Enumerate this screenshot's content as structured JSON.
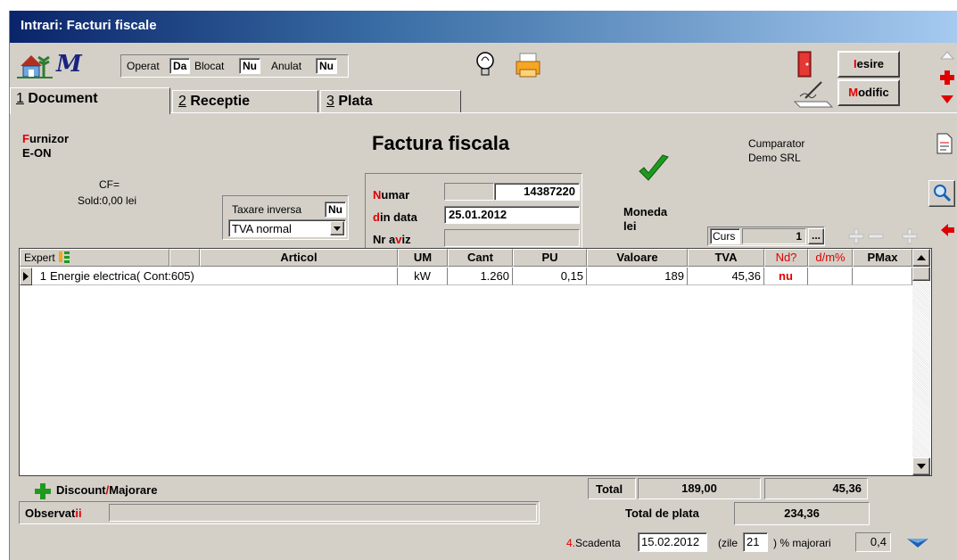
{
  "window": {
    "title": "Intrari: Facturi fiscale"
  },
  "toolbar": {
    "operat_label": "Operat",
    "operat_value": "Da",
    "blocat_label": "Blocat",
    "blocat_value": "Nu",
    "anulat_label": "Anulat",
    "anulat_value": "Nu",
    "iesire_hot": "I",
    "iesire_rest": "esire",
    "modific_hot": "M",
    "modific_rest": "odific"
  },
  "tabs": [
    {
      "num": "1",
      "label": "Document"
    },
    {
      "num": "2",
      "label": "Receptie"
    },
    {
      "num": "3",
      "label": "Plata"
    }
  ],
  "header": {
    "furnizor_hot": "F",
    "furnizor_rest": "urnizor",
    "furnizor_name": "E-ON",
    "cf_label": "CF=",
    "sold_label": "Sold:0,00 lei",
    "doc_title": "Factura fiscala",
    "cumparator_label": "Cumparator",
    "cumparator_name": "Demo SRL",
    "taxare_label": "Taxare inversa",
    "taxare_value": "Nu",
    "tva_select": "TVA normal",
    "numar_hot": "N",
    "numar_rest": "umar",
    "numar_series": "",
    "numar_value": "14387220",
    "din_hot": "d",
    "din_rest": "in data",
    "din_value": "25.01.2012",
    "aviz_pre": "Nr a",
    "aviz_hot": "v",
    "aviz_post": "iz",
    "aviz_value": "",
    "moneda_label": "Moneda",
    "moneda_value": "lei",
    "curs_label": "Curs",
    "curs_value": "1",
    "curs_btn": "..."
  },
  "grid": {
    "headers": {
      "expert": "Expert",
      "articol": "Articol",
      "um": "UM",
      "cant": "Cant",
      "pu": "PU",
      "valoare": "Valoare",
      "tva": "TVA",
      "nd": "Nd?",
      "dm": "d/m%",
      "pmax": "PMax"
    },
    "rows": [
      {
        "nr": "1",
        "articol": "Energie electrica( Cont:605)",
        "um": "kW",
        "cant": "1.260",
        "pu": "0,15",
        "valoare": "189",
        "tva": "45,36",
        "nd": "nu",
        "dm": "",
        "pmax": ""
      }
    ]
  },
  "footer": {
    "discount_label": "Discount",
    "majorare_label": "Majorare",
    "discount_sep": "/",
    "total_label": "Total",
    "total_value": "189,00",
    "total_tva": "45,36",
    "obs_pre": "Observat",
    "obs_hot": "ii",
    "obs_value": "",
    "total_plata_label": "Total de plata",
    "total_plata_value": "234,36",
    "scadenta_num": "4.",
    "scadenta_label": "Scadenta",
    "scadenta_value": "15.02.2012",
    "zile_label": "(zile",
    "zile_value": "21",
    "majorari_label": ") % majorari",
    "majorari_value": "0,4"
  },
  "colors": {
    "accent_red": "#e00000",
    "check_green": "#1f9a1f",
    "arrow_blue": "#1a5fb4"
  }
}
